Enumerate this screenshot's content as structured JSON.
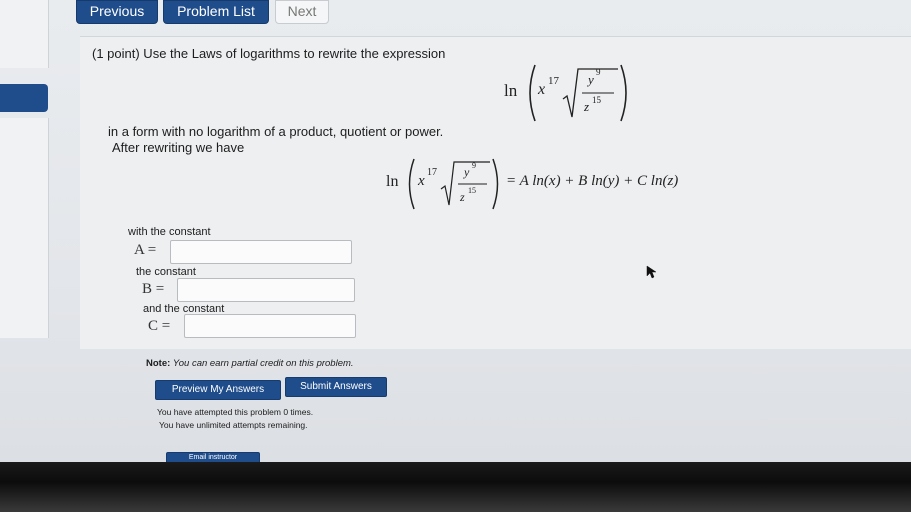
{
  "nav": {
    "previous": "Previous",
    "problem_list": "Problem List",
    "next": "Next"
  },
  "problem": {
    "intro": "(1 point) Use the Laws of logarithms to rewrite the expression",
    "expr_ln": "ln",
    "x_base": "x",
    "x_exp": "17",
    "frac_num_base": "y",
    "frac_num_exp": "9",
    "frac_den_base": "z",
    "frac_den_exp": "15",
    "instruction": "in a form with no logarithm of a product, quotient or power.",
    "after": "After rewriting we have",
    "rhs": "= A ln(x) + B ln(y) + C ln(z)"
  },
  "fields": {
    "a_prompt": "with the constant",
    "a_label": "A =",
    "a_value": "",
    "b_prompt": "the constant",
    "b_label": "B =",
    "b_value": "",
    "c_prompt": "and the constant",
    "c_label": "C =",
    "c_value": ""
  },
  "note": {
    "bold": "Note:",
    "text": "You can earn partial credit on this problem."
  },
  "buttons": {
    "preview": "Preview My Answers",
    "submit": "Submit Answers",
    "email": "Email instructor"
  },
  "status": {
    "attempts": "You have attempted this problem 0 times.",
    "remaining": "You have unlimited attempts remaining."
  },
  "colors": {
    "accent": "#1f4d8c",
    "panel": "#edeff1",
    "bezel": "#111111"
  }
}
